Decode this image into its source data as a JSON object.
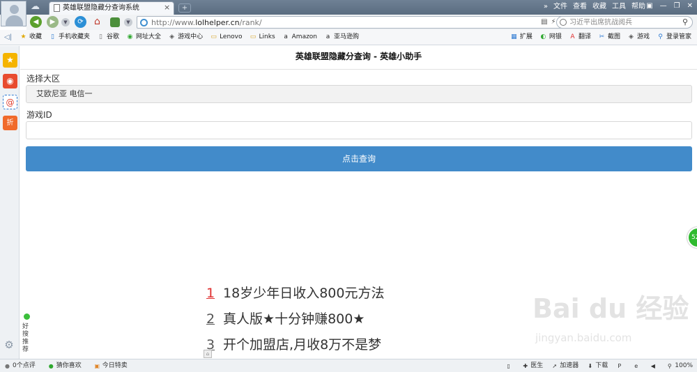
{
  "browser": {
    "tab_title": "英雄联盟隐藏分查询系统",
    "tab_close": "×",
    "new_tab": "+",
    "top_menu": [
      "»",
      "文件",
      "查看",
      "收藏",
      "工具",
      "帮助"
    ],
    "window_controls": [
      "▣",
      "—",
      "❐",
      "✕"
    ],
    "url": {
      "prefix": "http://www.",
      "domain": "lolhelper.cn",
      "path": "/rank/"
    },
    "url_tools": [
      "▤",
      "⚡",
      "⌄",
      "▸"
    ],
    "search_placeholder": "习近平出席抗战阅兵",
    "bookmarks": [
      {
        "icon": "star-icon",
        "glyph": "★",
        "label": "收藏"
      },
      {
        "icon": "phone-icon",
        "glyph": "▯",
        "label": "手机收藏夹"
      },
      {
        "icon": "page-icon",
        "glyph": "▯",
        "label": "谷歌"
      },
      {
        "icon": "globe-icon",
        "glyph": "◉",
        "label": "网址大全"
      },
      {
        "icon": "gamepad-icon",
        "glyph": "◈",
        "label": "游戏中心"
      },
      {
        "icon": "folder-icon",
        "glyph": "▭",
        "label": "Lenovo"
      },
      {
        "icon": "folder-icon",
        "glyph": "▭",
        "label": "Links"
      },
      {
        "icon": "amazon-icon",
        "glyph": "a",
        "label": "Amazon"
      },
      {
        "icon": "amazon-icon",
        "glyph": "a",
        "label": "亚马逊购"
      }
    ],
    "toolbar_right": [
      {
        "icon": "grid-icon",
        "glyph": "▦",
        "label": "扩展"
      },
      {
        "icon": "shield-icon",
        "glyph": "◐",
        "label": "网银"
      },
      {
        "icon": "translate-icon",
        "glyph": "A",
        "label": "翻译"
      },
      {
        "icon": "scissors-icon",
        "glyph": "✂",
        "label": "截图"
      },
      {
        "icon": "gamepad-icon",
        "glyph": "◈",
        "label": "游戏"
      },
      {
        "icon": "search-icon",
        "glyph": "⚲",
        "label": "登录管家"
      }
    ]
  },
  "sidebar": {
    "fav_glyph": "★",
    "weibo_glyph": "◉",
    "mail_glyph": "@",
    "discount_label": "折",
    "gear_glyph": "⚙"
  },
  "page": {
    "title": "英雄联盟隐藏分查询 - 英雄小助手",
    "region_label": "选择大区",
    "region_value": "艾欧尼亚 电信一",
    "gameid_label": "游戏ID",
    "gameid_value": "",
    "query_button": "点击查询",
    "float_badge": "52",
    "ads": [
      {
        "num": "1",
        "text": "18岁少年日收入800元方法"
      },
      {
        "num": "2",
        "text": "真人版★十分钟赚800★"
      },
      {
        "num": "3",
        "text": "开个加盟店,月收8万不是梦"
      }
    ],
    "recommend_label": "好搜推荐",
    "watermark": {
      "logo": "Bai du 经验",
      "url": "jingyan.baidu.com"
    }
  },
  "statusbar": {
    "left": [
      {
        "icon": "comment-icon",
        "glyph": "●",
        "label": "0个点评"
      },
      {
        "icon": "heart-icon",
        "glyph": "●",
        "label": "猜你喜欢"
      },
      {
        "icon": "gift-icon",
        "glyph": "▣",
        "label": "今日特卖"
      }
    ],
    "right": [
      {
        "icon": "phone-icon",
        "glyph": "▯",
        "label": ""
      },
      {
        "icon": "doctor-icon",
        "glyph": "✚",
        "label": "医生"
      },
      {
        "icon": "rocket-icon",
        "glyph": "➚",
        "label": "加速器"
      },
      {
        "icon": "download-icon",
        "glyph": "⬇",
        "label": "下载"
      },
      {
        "icon": "flag-icon",
        "glyph": "P",
        "label": ""
      },
      {
        "icon": "ie-icon",
        "glyph": "e",
        "label": ""
      },
      {
        "icon": "sound-icon",
        "glyph": "◀",
        "label": ""
      },
      {
        "icon": "zoom-icon",
        "glyph": "⚲",
        "label": "100%"
      }
    ]
  }
}
